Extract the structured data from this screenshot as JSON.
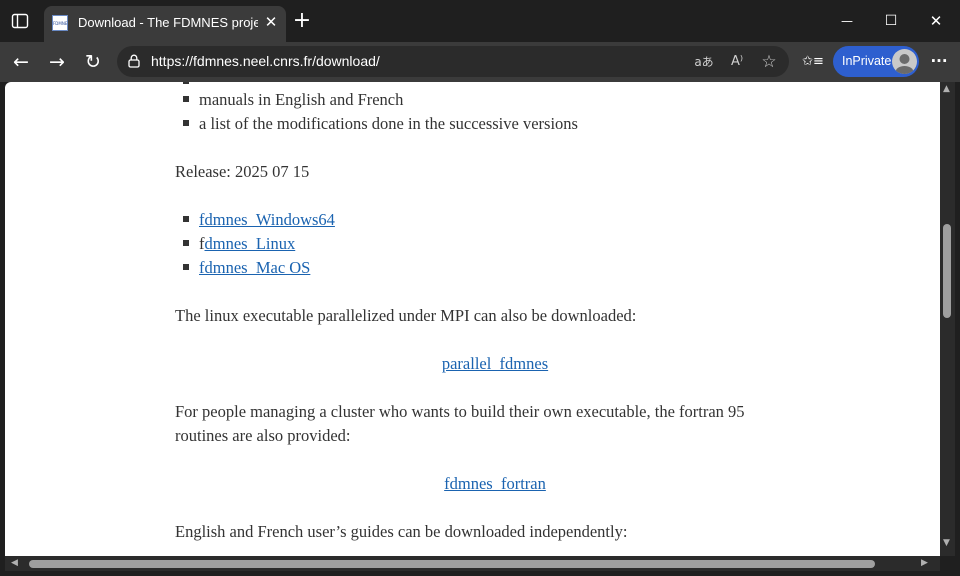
{
  "browser": {
    "tab": {
      "favicon_text": "FDMNES",
      "title": "Download - The FDMNES project",
      "close_glyph": "✕"
    },
    "new_tab_glyph": "+",
    "window_controls": {
      "minimize": "—",
      "maximize": "☐",
      "close": "✕"
    },
    "nav": {
      "back": "←",
      "forward": "→",
      "refresh": "↻"
    },
    "address": {
      "url": "https://fdmnes.neel.cnrs.fr/download/"
    },
    "address_icons": {
      "translate": "aあ",
      "read_aloud": "A⁾",
      "favorite": "☆"
    },
    "collections_glyph": "✩≡",
    "inprivate": {
      "label": "InPrivate"
    },
    "menu_glyph": "···"
  },
  "page": {
    "top_list": [
      "manuals in English and French",
      "a list of the modifications done in the successive versions"
    ],
    "release": "Release: 2025 07 15",
    "downloads": [
      {
        "label": "fdmnes_Windows64",
        "prefix": "",
        "link_text": "fdmnes_Windows64"
      },
      {
        "label": "fdmnes_Linux",
        "prefix": "f",
        "link_text": "dmnes_Linux"
      },
      {
        "label": "fdmnes_Mac OS",
        "prefix": "",
        "link_text": "fdmnes_Mac OS"
      }
    ],
    "mpi_text": "The linux executable parallelized under MPI can also be downloaded:",
    "parallel_link": "parallel_fdmnes",
    "cluster_text_1": "For people managing a cluster who wants to build their own executable, the fortran 95",
    "cluster_text_2": "routines are also provided:",
    "fortran_link": "fdmnes_fortran",
    "guides_text": "English and French user’s guides can be downloaded independently:"
  },
  "colors": {
    "link": "#1a63b0",
    "inprivate_badge": "#2e5fcf",
    "chrome_dark": "#1f1f1f",
    "toolbar": "#3b3b3b"
  }
}
